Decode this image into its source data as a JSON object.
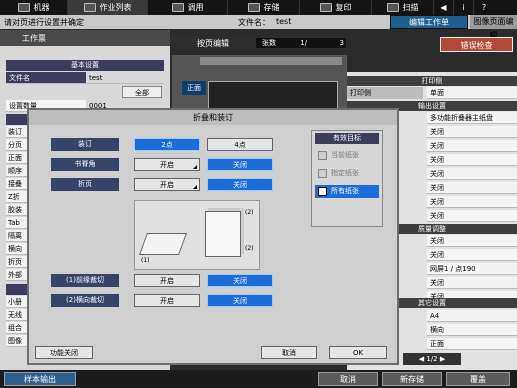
{
  "top_tabs": [
    {
      "label": "机器",
      "icon": "machine-icon"
    },
    {
      "label": "作业列表",
      "icon": "job-list-icon"
    },
    {
      "label": "调用",
      "icon": "recall-icon"
    },
    {
      "label": "存储",
      "icon": "store-icon"
    },
    {
      "label": "复印",
      "icon": "copy-icon"
    },
    {
      "label": "扫描",
      "icon": "scan-icon"
    }
  ],
  "message": "请对页进行设置并确定",
  "file_name_label": "文件名：",
  "file_name": "test",
  "tab_edit_job": "编辑工作单",
  "tab_image_page": "图像页面编辑",
  "left_header": "工作票",
  "basic_settings": "基本设置",
  "file_name_row_label": "文件名",
  "file_name_row_value": "test",
  "all_button": "全部",
  "settings_count_label": "设置数量",
  "settings_count_value": "0001",
  "left_items": [
    "装订",
    "分页",
    "正面",
    "顺序",
    "接叠",
    "Z折",
    "胶装",
    "Tab",
    "隔离",
    "横向",
    "折页",
    "外部",
    "小册",
    "无线",
    "组合",
    "图像"
  ],
  "page_edit_label": "按页编辑",
  "sheet_count_label": "张数",
  "sheet_count_value": "1/",
  "sheet_count_total": "3",
  "error_check": "错误检查",
  "front_label": "正面",
  "right": {
    "print_side_header": "打印侧",
    "print_side_label": "打印侧",
    "print_side_value": "单面",
    "output_header": "输出设置",
    "output_rows": [
      "多功能折叠器主纸盘",
      "关闭",
      "关闭",
      "关闭",
      "关闭",
      "关闭",
      "关闭",
      "关闭"
    ],
    "quality_header": "质量调整",
    "quality_rows": [
      "关闭",
      "关闭",
      "网屏1 / 点190",
      "关闭",
      "关闭"
    ],
    "other_header": "其它设置",
    "other_rows": [
      "A4",
      "横向",
      "正面"
    ],
    "pager": "1/2"
  },
  "bottom": {
    "sample_output": "样本输出",
    "cancel": "取消",
    "new_store": "新存储",
    "overwrite": "覆盖"
  },
  "dialog": {
    "title": "折叠和装订",
    "staple_label": "装订",
    "staple_2": "2点",
    "staple_4": "4点",
    "spine_label": "书脊角",
    "on": "开启",
    "off": "关闭",
    "fold_label": "折页",
    "fore_edge_label": "(1)前缘裁切",
    "cross_cut_label": "(2)横向裁切",
    "illus_1": "(1)",
    "illus_2": "(2)",
    "target_header": "有效目标",
    "target_current": "当前纸张",
    "target_specified": "指定纸张",
    "target_all": "所有纸张",
    "function_off": "功能关闭",
    "cancel": "取消",
    "ok": "OK"
  }
}
